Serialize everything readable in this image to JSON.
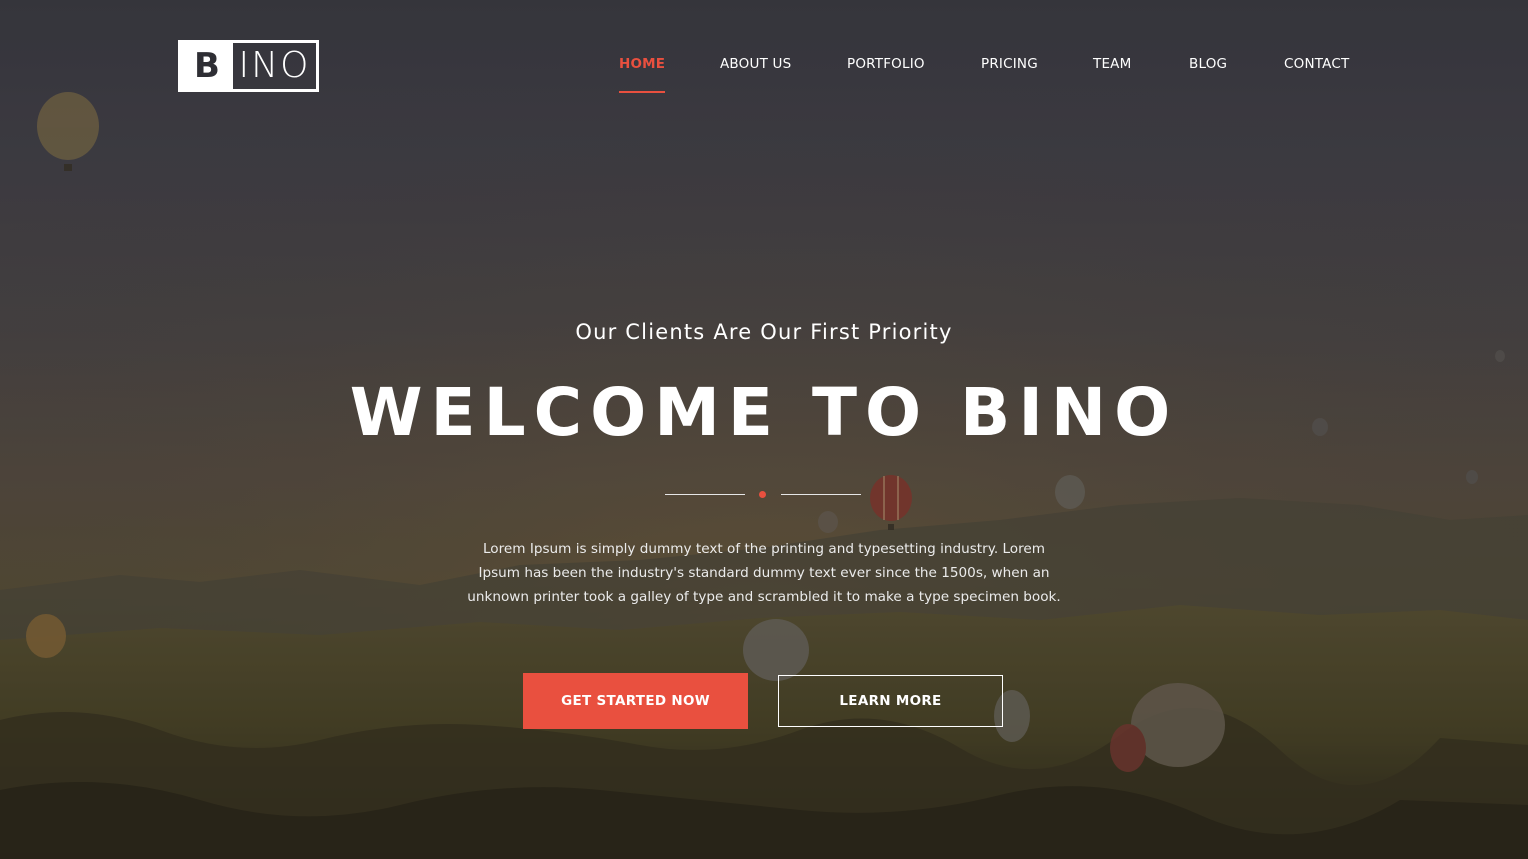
{
  "brand": {
    "logo_initial": "B",
    "logo_rest": "INO"
  },
  "nav": {
    "items": [
      {
        "label": "HOME",
        "active": true
      },
      {
        "label": "ABOUT US",
        "active": false
      },
      {
        "label": "PORTFOLIO",
        "active": false
      },
      {
        "label": "PRICING",
        "active": false
      },
      {
        "label": "TEAM",
        "active": false
      },
      {
        "label": "BLOG",
        "active": false
      },
      {
        "label": "CONTACT",
        "active": false
      }
    ]
  },
  "hero": {
    "subtitle": "Our Clients Are Our First Priority",
    "title": "WELCOME TO BINO",
    "description": "Lorem Ipsum is simply dummy text of the printing and typesetting industry. Lorem Ipsum has been the industry's standard dummy text ever since the 1500s, when an unknown printer took a galley of type and scrambled it to make a type specimen book.",
    "primary_button": "GET STARTED NOW",
    "secondary_button": "LEARN MORE"
  },
  "colors": {
    "accent": "#e9503f",
    "text": "#ffffff"
  }
}
